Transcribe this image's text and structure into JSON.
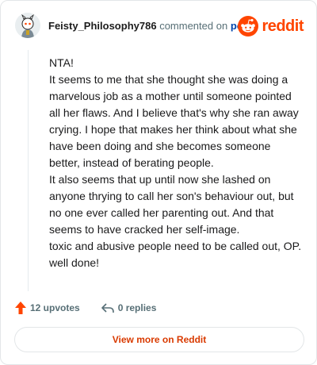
{
  "header": {
    "username": "Feisty_Philosophy786",
    "action_text": "commented on",
    "post_link": "post",
    "brand": "reddit",
    "avatar_icon": "snoo-avatar-icon",
    "brand_icon": "reddit-logo-icon",
    "brand_color": "#ff4500"
  },
  "comment": {
    "paragraphs": [
      "NTA!",
      "It seems to me that she thought she was doing a marvelous job as a mother until someone pointed all her flaws. And I believe that's why she ran away crying. I hope that makes her think about what she have been doing and she becomes someone better, instead of berating people.",
      "It also seems that up until now she lashed on anyone thrying to call her son's behaviour out, but no one ever called her parenting out. And that seems to have cracked her self-image.",
      "toxic and abusive people need to be called out, OP. well done!"
    ]
  },
  "actions": {
    "upvotes": "12 upvotes",
    "replies": "0 replies",
    "upvote_icon": "upvote-arrow-icon",
    "reply_icon": "reply-arrow-icon",
    "upvote_color": "#ff4500"
  },
  "cta": {
    "label": "View more on Reddit"
  }
}
